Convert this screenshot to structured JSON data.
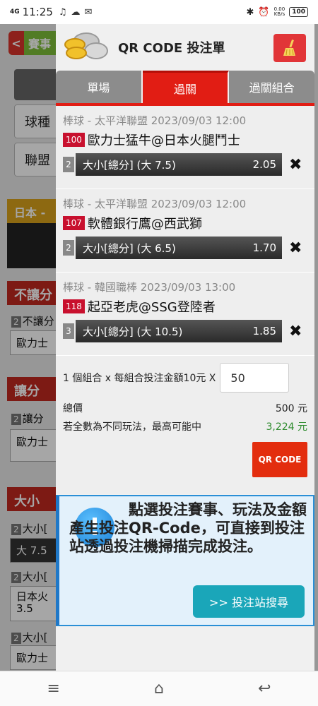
{
  "status_bar": {
    "signal": "4G",
    "time": "11:25",
    "net_speed_value": "0.00",
    "net_speed_unit": "KB/s",
    "battery": "100"
  },
  "background_page": {
    "back_label": "賽事",
    "field1": "球種",
    "field2": "聯盟",
    "section_gold": "日本 -",
    "section_nohandicap": "不讓分",
    "line1_idx": "2",
    "line1": "不讓分",
    "field_team1": "歐力士",
    "section_handicap": "讓分",
    "line2_idx": "2",
    "line2": "讓分",
    "field_team2": "歐力士",
    "section_total": "大小",
    "line3_idx": "2",
    "line3": "大小[",
    "dark_field": "大 7.5",
    "line4_idx": "2",
    "line4": "大小[",
    "field_team3a": "日本火",
    "field_team3b": "3.5",
    "line5_idx": "2",
    "line5": "大小[",
    "field_team4": "歐力士"
  },
  "panel": {
    "title": "QR CODE 投注單",
    "tabs": [
      {
        "label": "單場"
      },
      {
        "label": "過關"
      },
      {
        "label": "過關組合"
      }
    ],
    "active_tab": "過關",
    "bets": [
      {
        "league": "棒球 - 太平洋聯盟 2023/09/03 12:00",
        "num": "100",
        "teams": "歐力士猛牛@日本火腿鬥士",
        "idx": "2",
        "pick": "大小[總分] (大 7.5)",
        "odds": "2.05"
      },
      {
        "league": "棒球 - 太平洋聯盟 2023/09/03 12:00",
        "num": "107",
        "teams": "軟體銀行鷹@西武獅",
        "idx": "2",
        "pick": "大小[總分] (大 6.5)",
        "odds": "1.70"
      },
      {
        "league": "棒球 - 韓國職棒 2023/09/03 13:00",
        "num": "118",
        "teams": "起亞老虎@SSG登陸者",
        "idx": "3",
        "pick": "大小[總分] (大 10.5)",
        "odds": "1.85"
      }
    ],
    "summary": {
      "combo_text": "1 個組合 x 每組合投注金額10元 X",
      "amount": "50",
      "total_label": "總價",
      "total_value": "500 元",
      "max_label": "若全數為不同玩法，最高可能中",
      "max_value": "3,224 元",
      "qr_button": "QR CODE"
    },
    "info": {
      "icon": "!",
      "text": "點選投注賽事、玩法及金額產生投注QR-Code，可直接到投注站透過投注機掃描完成投注。",
      "search_button": ">> 投注站搜尋"
    }
  },
  "colors": {
    "accent_red": "#e11d14",
    "odds_green": "#2e8b2e",
    "info_blue": "#2a8fd6",
    "search_teal": "#1aa6b9"
  },
  "nav": {
    "menu": "≡",
    "home": "⌂",
    "back": "↩"
  }
}
